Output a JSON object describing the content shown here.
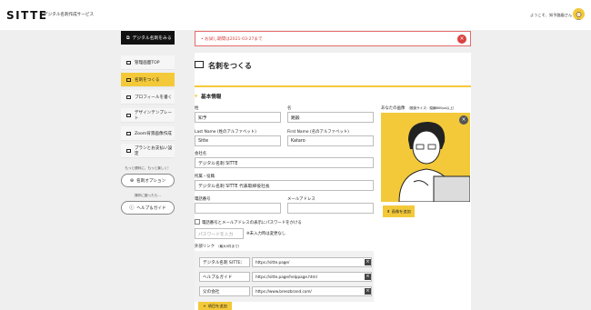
{
  "header": {
    "logo": "SITTE",
    "logo_sub": "デジタル名刺作成サービス",
    "welcome": "ようこそ、知予路鍛さん"
  },
  "sidebar": {
    "top_button": "デジタル名刺をみる",
    "items": [
      {
        "label": "管理画面TOP",
        "icon": "home-icon"
      },
      {
        "label": "名刺をつくる",
        "icon": "card-icon",
        "active": true
      },
      {
        "label": "プロフィールを書く",
        "icon": "profile-icon"
      },
      {
        "label": "デザインテンプレート",
        "icon": "template-icon"
      },
      {
        "label": "Zoom背景画像作成",
        "icon": "zoom-icon"
      },
      {
        "label": "プランとお支払い設定",
        "icon": "payment-icon"
      }
    ],
    "note1": "もっと便利に、もっと楽しく！",
    "option_button": "名刺オプション",
    "note2": "操作に困ったら…",
    "help_button": "ヘルプ＆ガイド"
  },
  "alert": {
    "text": "お試し期間は2021-03-27まで"
  },
  "page": {
    "title": "名刺をつくる",
    "section": "基本情報",
    "fields": {
      "last_name_label": "姓",
      "last_name": "知予",
      "first_name_label": "名",
      "first_name": "路鍛",
      "last_name_en_label": "Last Name (姓のアルファベット)",
      "last_name_en": "Sitte",
      "first_name_en_label": "First Name (名のアルファベット)",
      "first_name_en": "Kataro",
      "company_label": "会社名",
      "company": "デジタル名刺 SITTE",
      "position_label": "所属・役職",
      "position": "デジタル名刺 SITTE 代表取締役社長",
      "phone_label": "電話番号",
      "phone": "",
      "email_label": "メールアドレス",
      "email": "",
      "password_check_label": "電話番号とメールアドレスの表示にパスワードをかける",
      "password_placeholder": "パスワードを入力",
      "password_note": "※未入力時は変更なし"
    },
    "photo": {
      "label": "あなたの画像",
      "label_note": "（推奨サイズ：縦横600px以上）",
      "upload_button": "画像を追加"
    },
    "links": {
      "label": "外部リンク",
      "label_note": "（最大5件まで）",
      "rows": [
        {
          "name": "デジタル名刺 SITTE：",
          "url": "https://sitte.page/"
        },
        {
          "name": "ヘルプ＆ガイド",
          "url": "https://sitte.page/helppage.html"
        },
        {
          "name": "父の会社",
          "url": "https://www.breezbrand.com/"
        }
      ],
      "add_button": "項目を追加"
    }
  }
}
